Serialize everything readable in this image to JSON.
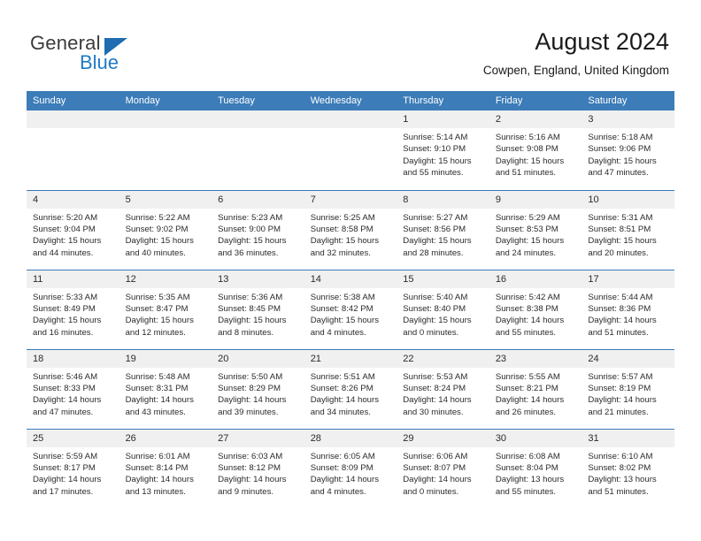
{
  "brand": {
    "name_part1": "General",
    "name_part2": "Blue",
    "accent_color": "#1f7bc4"
  },
  "header": {
    "title": "August 2024",
    "location": "Cowpen, England, United Kingdom"
  },
  "calendar": {
    "header_color": "#3c7cb8",
    "daynum_bg": "#f0f0f0",
    "weekday_headers": [
      "Sunday",
      "Monday",
      "Tuesday",
      "Wednesday",
      "Thursday",
      "Friday",
      "Saturday"
    ],
    "weeks": [
      [
        {
          "day": "",
          "empty": true
        },
        {
          "day": "",
          "empty": true
        },
        {
          "day": "",
          "empty": true
        },
        {
          "day": "",
          "empty": true
        },
        {
          "day": "1",
          "sunrise": "Sunrise: 5:14 AM",
          "sunset": "Sunset: 9:10 PM",
          "daylight1": "Daylight: 15 hours",
          "daylight2": "and 55 minutes."
        },
        {
          "day": "2",
          "sunrise": "Sunrise: 5:16 AM",
          "sunset": "Sunset: 9:08 PM",
          "daylight1": "Daylight: 15 hours",
          "daylight2": "and 51 minutes."
        },
        {
          "day": "3",
          "sunrise": "Sunrise: 5:18 AM",
          "sunset": "Sunset: 9:06 PM",
          "daylight1": "Daylight: 15 hours",
          "daylight2": "and 47 minutes."
        }
      ],
      [
        {
          "day": "4",
          "sunrise": "Sunrise: 5:20 AM",
          "sunset": "Sunset: 9:04 PM",
          "daylight1": "Daylight: 15 hours",
          "daylight2": "and 44 minutes."
        },
        {
          "day": "5",
          "sunrise": "Sunrise: 5:22 AM",
          "sunset": "Sunset: 9:02 PM",
          "daylight1": "Daylight: 15 hours",
          "daylight2": "and 40 minutes."
        },
        {
          "day": "6",
          "sunrise": "Sunrise: 5:23 AM",
          "sunset": "Sunset: 9:00 PM",
          "daylight1": "Daylight: 15 hours",
          "daylight2": "and 36 minutes."
        },
        {
          "day": "7",
          "sunrise": "Sunrise: 5:25 AM",
          "sunset": "Sunset: 8:58 PM",
          "daylight1": "Daylight: 15 hours",
          "daylight2": "and 32 minutes."
        },
        {
          "day": "8",
          "sunrise": "Sunrise: 5:27 AM",
          "sunset": "Sunset: 8:56 PM",
          "daylight1": "Daylight: 15 hours",
          "daylight2": "and 28 minutes."
        },
        {
          "day": "9",
          "sunrise": "Sunrise: 5:29 AM",
          "sunset": "Sunset: 8:53 PM",
          "daylight1": "Daylight: 15 hours",
          "daylight2": "and 24 minutes."
        },
        {
          "day": "10",
          "sunrise": "Sunrise: 5:31 AM",
          "sunset": "Sunset: 8:51 PM",
          "daylight1": "Daylight: 15 hours",
          "daylight2": "and 20 minutes."
        }
      ],
      [
        {
          "day": "11",
          "sunrise": "Sunrise: 5:33 AM",
          "sunset": "Sunset: 8:49 PM",
          "daylight1": "Daylight: 15 hours",
          "daylight2": "and 16 minutes."
        },
        {
          "day": "12",
          "sunrise": "Sunrise: 5:35 AM",
          "sunset": "Sunset: 8:47 PM",
          "daylight1": "Daylight: 15 hours",
          "daylight2": "and 12 minutes."
        },
        {
          "day": "13",
          "sunrise": "Sunrise: 5:36 AM",
          "sunset": "Sunset: 8:45 PM",
          "daylight1": "Daylight: 15 hours",
          "daylight2": "and 8 minutes."
        },
        {
          "day": "14",
          "sunrise": "Sunrise: 5:38 AM",
          "sunset": "Sunset: 8:42 PM",
          "daylight1": "Daylight: 15 hours",
          "daylight2": "and 4 minutes."
        },
        {
          "day": "15",
          "sunrise": "Sunrise: 5:40 AM",
          "sunset": "Sunset: 8:40 PM",
          "daylight1": "Daylight: 15 hours",
          "daylight2": "and 0 minutes."
        },
        {
          "day": "16",
          "sunrise": "Sunrise: 5:42 AM",
          "sunset": "Sunset: 8:38 PM",
          "daylight1": "Daylight: 14 hours",
          "daylight2": "and 55 minutes."
        },
        {
          "day": "17",
          "sunrise": "Sunrise: 5:44 AM",
          "sunset": "Sunset: 8:36 PM",
          "daylight1": "Daylight: 14 hours",
          "daylight2": "and 51 minutes."
        }
      ],
      [
        {
          "day": "18",
          "sunrise": "Sunrise: 5:46 AM",
          "sunset": "Sunset: 8:33 PM",
          "daylight1": "Daylight: 14 hours",
          "daylight2": "and 47 minutes."
        },
        {
          "day": "19",
          "sunrise": "Sunrise: 5:48 AM",
          "sunset": "Sunset: 8:31 PM",
          "daylight1": "Daylight: 14 hours",
          "daylight2": "and 43 minutes."
        },
        {
          "day": "20",
          "sunrise": "Sunrise: 5:50 AM",
          "sunset": "Sunset: 8:29 PM",
          "daylight1": "Daylight: 14 hours",
          "daylight2": "and 39 minutes."
        },
        {
          "day": "21",
          "sunrise": "Sunrise: 5:51 AM",
          "sunset": "Sunset: 8:26 PM",
          "daylight1": "Daylight: 14 hours",
          "daylight2": "and 34 minutes."
        },
        {
          "day": "22",
          "sunrise": "Sunrise: 5:53 AM",
          "sunset": "Sunset: 8:24 PM",
          "daylight1": "Daylight: 14 hours",
          "daylight2": "and 30 minutes."
        },
        {
          "day": "23",
          "sunrise": "Sunrise: 5:55 AM",
          "sunset": "Sunset: 8:21 PM",
          "daylight1": "Daylight: 14 hours",
          "daylight2": "and 26 minutes."
        },
        {
          "day": "24",
          "sunrise": "Sunrise: 5:57 AM",
          "sunset": "Sunset: 8:19 PM",
          "daylight1": "Daylight: 14 hours",
          "daylight2": "and 21 minutes."
        }
      ],
      [
        {
          "day": "25",
          "sunrise": "Sunrise: 5:59 AM",
          "sunset": "Sunset: 8:17 PM",
          "daylight1": "Daylight: 14 hours",
          "daylight2": "and 17 minutes."
        },
        {
          "day": "26",
          "sunrise": "Sunrise: 6:01 AM",
          "sunset": "Sunset: 8:14 PM",
          "daylight1": "Daylight: 14 hours",
          "daylight2": "and 13 minutes."
        },
        {
          "day": "27",
          "sunrise": "Sunrise: 6:03 AM",
          "sunset": "Sunset: 8:12 PM",
          "daylight1": "Daylight: 14 hours",
          "daylight2": "and 9 minutes."
        },
        {
          "day": "28",
          "sunrise": "Sunrise: 6:05 AM",
          "sunset": "Sunset: 8:09 PM",
          "daylight1": "Daylight: 14 hours",
          "daylight2": "and 4 minutes."
        },
        {
          "day": "29",
          "sunrise": "Sunrise: 6:06 AM",
          "sunset": "Sunset: 8:07 PM",
          "daylight1": "Daylight: 14 hours",
          "daylight2": "and 0 minutes."
        },
        {
          "day": "30",
          "sunrise": "Sunrise: 6:08 AM",
          "sunset": "Sunset: 8:04 PM",
          "daylight1": "Daylight: 13 hours",
          "daylight2": "and 55 minutes."
        },
        {
          "day": "31",
          "sunrise": "Sunrise: 6:10 AM",
          "sunset": "Sunset: 8:02 PM",
          "daylight1": "Daylight: 13 hours",
          "daylight2": "and 51 minutes."
        }
      ]
    ]
  }
}
